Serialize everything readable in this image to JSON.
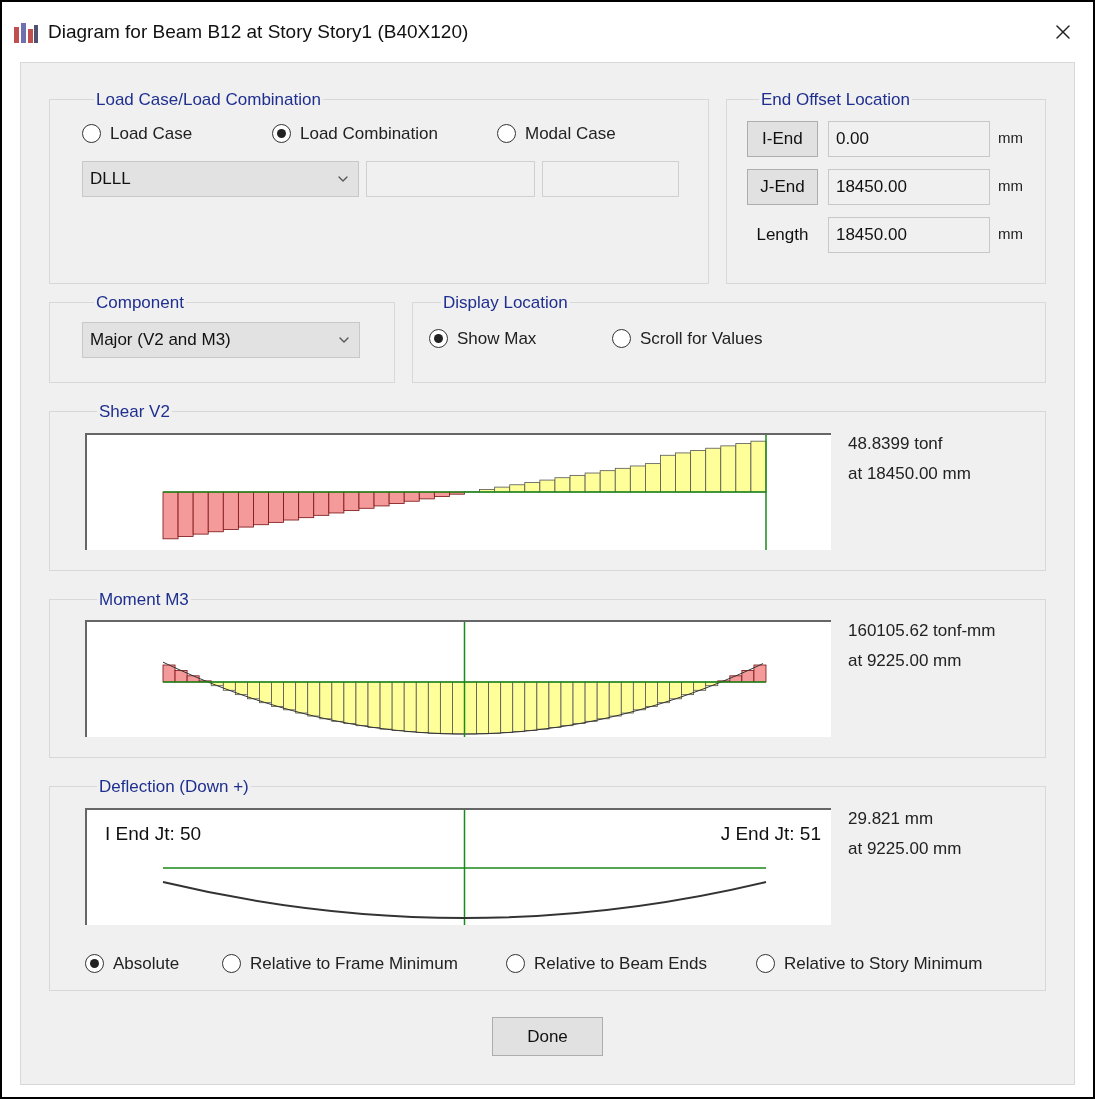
{
  "window": {
    "title": "Diagram for Beam B12 at Story Story1 (B40X120)"
  },
  "load_case": {
    "title": "Load Case/Load Combination",
    "options": [
      {
        "label": "Load Case",
        "selected": false
      },
      {
        "label": "Load Combination",
        "selected": true
      },
      {
        "label": "Modal Case",
        "selected": false
      }
    ],
    "combination": "DLLL"
  },
  "end_offset": {
    "title": "End Offset Location",
    "rows": [
      {
        "kind": "button",
        "label": "I-End",
        "value": "0.00",
        "unit": "mm"
      },
      {
        "kind": "button",
        "label": "J-End",
        "value": "18450.00",
        "unit": "mm"
      },
      {
        "kind": "label",
        "label": "Length",
        "value": "18450.00",
        "unit": "mm"
      }
    ]
  },
  "component": {
    "title": "Component",
    "value": "Major (V2 and M3)"
  },
  "display_location": {
    "title": "Display Location",
    "options": [
      {
        "label": "Show Max",
        "selected": true
      },
      {
        "label": "Scroll for Values",
        "selected": false
      }
    ]
  },
  "diagrams": [
    {
      "kind": "shear",
      "title": "Shear V2",
      "max_value": "48.8399 tonf",
      "max_location": "at 18450.00 mm"
    },
    {
      "kind": "moment",
      "title": "Moment M3",
      "max_value": "160105.62 tonf-mm",
      "max_location": "at 9225.00 mm"
    },
    {
      "kind": "deflection",
      "title": "Deflection (Down +)",
      "max_value": "29.821 mm",
      "max_location": "at 9225.00 mm",
      "i_end_label": "I End Jt: 50",
      "j_end_label": "J End Jt: 51",
      "modes": [
        {
          "label": "Absolute",
          "selected": true
        },
        {
          "label": "Relative to Frame Minimum",
          "selected": false
        },
        {
          "label": "Relative to Beam Ends",
          "selected": false
        },
        {
          "label": "Relative to Story Minimum",
          "selected": false
        }
      ]
    }
  ],
  "done_button": "Done"
}
